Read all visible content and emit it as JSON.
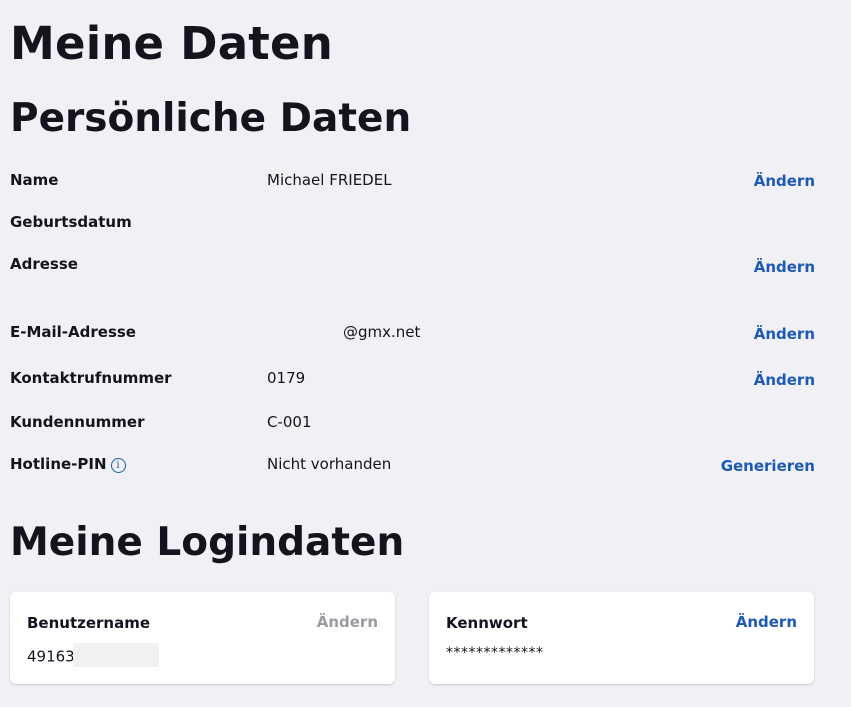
{
  "page": {
    "title": "Meine Daten"
  },
  "personal": {
    "heading": "Persönliche Daten",
    "rows": [
      {
        "label": "Name",
        "value": "Michael FRIEDEL",
        "action": "Ändern"
      },
      {
        "label": "Geburtsdatum",
        "value": "",
        "action": ""
      },
      {
        "label": "Adresse",
        "value": "",
        "action": "Ändern"
      },
      {
        "label": "E-Mail-Adresse",
        "value": "@gmx.net",
        "action": "Ändern"
      },
      {
        "label": "Kontaktrufnummer",
        "value": "0179",
        "action": "Ändern"
      },
      {
        "label": "Kundennummer",
        "value": "C-001",
        "action": ""
      },
      {
        "label": "Hotline-PIN",
        "value": "Nicht vorhanden",
        "action": "Generieren",
        "info_icon": "info-icon"
      }
    ]
  },
  "login": {
    "heading": "Meine Logindaten",
    "username": {
      "label": "Benutzername",
      "value": "49163",
      "action": "Ändern",
      "action_state": "disabled"
    },
    "password": {
      "label": "Kennwort",
      "value": "*************",
      "action": "Ändern"
    }
  },
  "colors": {
    "background": "#f0f0f5",
    "text": "#14141e",
    "link": "#1e5ab4",
    "disabled": "#9a9aa0",
    "card": "#ffffff"
  }
}
